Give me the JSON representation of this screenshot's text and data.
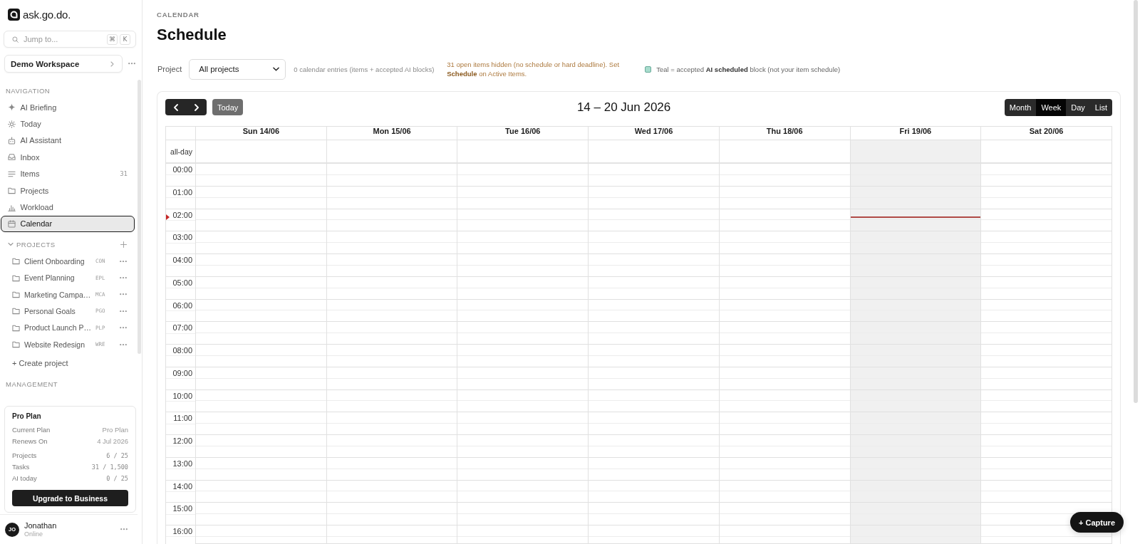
{
  "sidebar": {
    "logo_text": "ask.go.do.",
    "search": {
      "placeholder": "Jump to...",
      "shortcut_keys": [
        "⌘",
        "K"
      ]
    },
    "workspace": "Demo Workspace",
    "navigation": {
      "heading": "NAVIGATION",
      "items": [
        {
          "label": "AI Briefing",
          "selected": false
        },
        {
          "label": "Today",
          "selected": false
        },
        {
          "label": "AI Assistant",
          "selected": false
        },
        {
          "label": "Inbox",
          "selected": false
        },
        {
          "label": "Items",
          "count": "31",
          "selected": false
        },
        {
          "label": "Projects",
          "selected": false
        },
        {
          "label": "Workload",
          "selected": false
        },
        {
          "label": "Calendar",
          "selected": true
        }
      ]
    },
    "projects": {
      "heading": "PROJECTS",
      "expanded": true,
      "items": [
        {
          "name": "Client Onboarding",
          "code": "CON"
        },
        {
          "name": "Event Planning",
          "code": "EPL"
        },
        {
          "name": "Marketing Campa…",
          "code": "MCA"
        },
        {
          "name": "Personal Goals",
          "code": "PGO"
        },
        {
          "name": "Product Launch P…",
          "code": "PLP"
        },
        {
          "name": "Website Redesign",
          "code": "WRE"
        }
      ],
      "create_label": "+ Create project"
    },
    "management": {
      "heading": "MANAGEMENT"
    },
    "plan": {
      "title": "Pro Plan",
      "rows": [
        {
          "label": "Current Plan",
          "value": "Pro Plan",
          "kind": "info"
        },
        {
          "label": "Renews On",
          "value": "4 Jul 2026",
          "kind": "info"
        },
        {
          "label": "Projects",
          "value": "6 / 25",
          "kind": "usage"
        },
        {
          "label": "Tasks",
          "value": "31 / 1,500",
          "kind": "usage"
        },
        {
          "label": "AI today",
          "value": "0 / 25",
          "kind": "usage"
        }
      ],
      "button": "Upgrade to Business"
    },
    "user": {
      "initials": "JO",
      "name": "Jonathan",
      "status": "Online"
    }
  },
  "page": {
    "breadcrumb": "CALENDAR",
    "title": "Schedule"
  },
  "filters": {
    "project_label": "Project",
    "project_value": "All projects",
    "entries_note": "0 calendar entries (items + accepted AI blocks)",
    "hidden_warning": "31 open items hidden (no schedule or hard deadline). Set **Schedule** on Active Items.",
    "legend": {
      "color": "#a8dccd",
      "text": "Teal = accepted **AI scheduled** block (not your item schedule)"
    }
  },
  "calendar": {
    "today_button": {
      "label": "Today",
      "disabled": true
    },
    "range_title": "14 – 20 Jun 2026",
    "views": [
      {
        "label": "Month",
        "selected": false
      },
      {
        "label": "Week",
        "selected": true
      },
      {
        "label": "Day",
        "selected": false
      },
      {
        "label": "List",
        "selected": false
      }
    ],
    "all_day_label": "all-day",
    "days": [
      {
        "label": "Sun 14/06",
        "today": false
      },
      {
        "label": "Mon 15/06",
        "today": false
      },
      {
        "label": "Tue 16/06",
        "today": false
      },
      {
        "label": "Wed 17/06",
        "today": false
      },
      {
        "label": "Thu 18/06",
        "today": false
      },
      {
        "label": "Fri 19/06",
        "today": true
      },
      {
        "label": "Sat 20/06",
        "today": false
      }
    ],
    "hours": [
      {
        "label": "00:00",
        "now": false
      },
      {
        "label": "01:00",
        "now": false
      },
      {
        "label": "02:00",
        "now": true
      },
      {
        "label": "03:00",
        "now": false
      },
      {
        "label": "04:00",
        "now": false
      },
      {
        "label": "05:00",
        "now": false
      },
      {
        "label": "06:00",
        "now": false
      },
      {
        "label": "07:00",
        "now": false
      },
      {
        "label": "08:00",
        "now": false
      },
      {
        "label": "09:00",
        "now": false
      },
      {
        "label": "10:00",
        "now": false
      },
      {
        "label": "11:00",
        "now": false
      },
      {
        "label": "12:00",
        "now": false
      },
      {
        "label": "13:00",
        "now": false
      },
      {
        "label": "14:00",
        "now": false
      },
      {
        "label": "15:00",
        "now": false
      },
      {
        "label": "16:00",
        "now": false
      }
    ]
  },
  "capture_button": "+ Capture"
}
